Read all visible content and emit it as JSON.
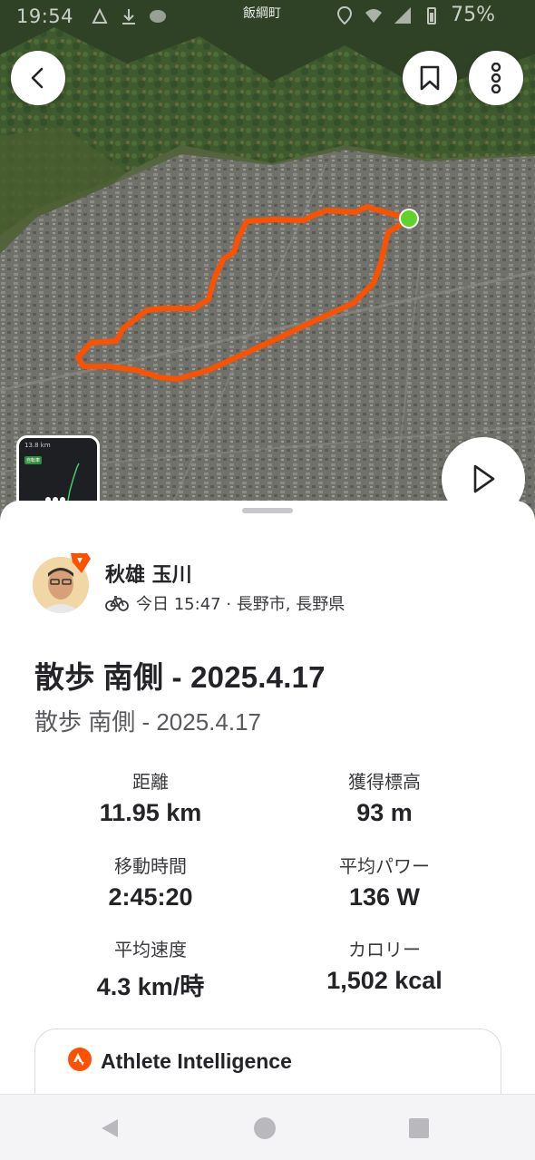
{
  "status_bar": {
    "time": "19:54",
    "carrier": "飯綱町",
    "battery": "75%"
  },
  "map": {
    "route_color": "#fc5200",
    "end_marker_color": "#5fd32a",
    "thumbnail": {
      "stat": "13.8 km",
      "badge": "自転車"
    }
  },
  "icons": {
    "back": "chevron-left-icon",
    "bookmark": "bookmark-icon",
    "more": "more-vertical-icon",
    "play": "play-icon",
    "activity": "bike-icon",
    "ai": "strava-logo-icon"
  },
  "athlete": {
    "name": "秋雄 玉川",
    "meta": "今日 15:47 · 長野市, 長野県"
  },
  "activity": {
    "title": "散歩 南側 - 2025.4.17",
    "description": "散歩 南側 - 2025.4.17"
  },
  "stats": [
    {
      "label": "距離",
      "value": "11.95 km"
    },
    {
      "label": "獲得標高",
      "value": "93 m"
    },
    {
      "label": "移動時間",
      "value": "2:45:20"
    },
    {
      "label": "平均パワー",
      "value": "136 W"
    },
    {
      "label": "平均速度",
      "value": "4.3 km/時"
    },
    {
      "label": "カロリー",
      "value": "1,502 kcal"
    }
  ],
  "athlete_intelligence": {
    "title": "Athlete Intelligence"
  },
  "colors": {
    "accent": "#fc5200",
    "text": "#242428"
  }
}
